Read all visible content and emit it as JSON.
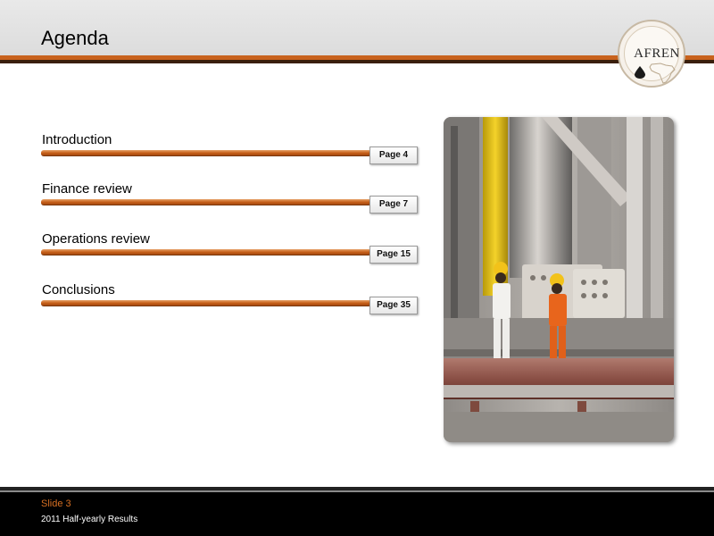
{
  "header": {
    "title": "Agenda"
  },
  "logo": {
    "text": "AFREN"
  },
  "agenda": [
    {
      "label": "Introduction",
      "page": "Page 4"
    },
    {
      "label": "Finance review",
      "page": "Page 7"
    },
    {
      "label": "Operations review",
      "page": "Page 15"
    },
    {
      "label": "Conclusions",
      "page": "Page 35"
    }
  ],
  "footer": {
    "slide": "Slide 3",
    "subtitle": "2011 Half-yearly Results"
  },
  "colors": {
    "accent": "#c8621d",
    "dark_band": "#3a1f0c",
    "footer_bg": "#000000",
    "slide_text": "#d66f22"
  }
}
